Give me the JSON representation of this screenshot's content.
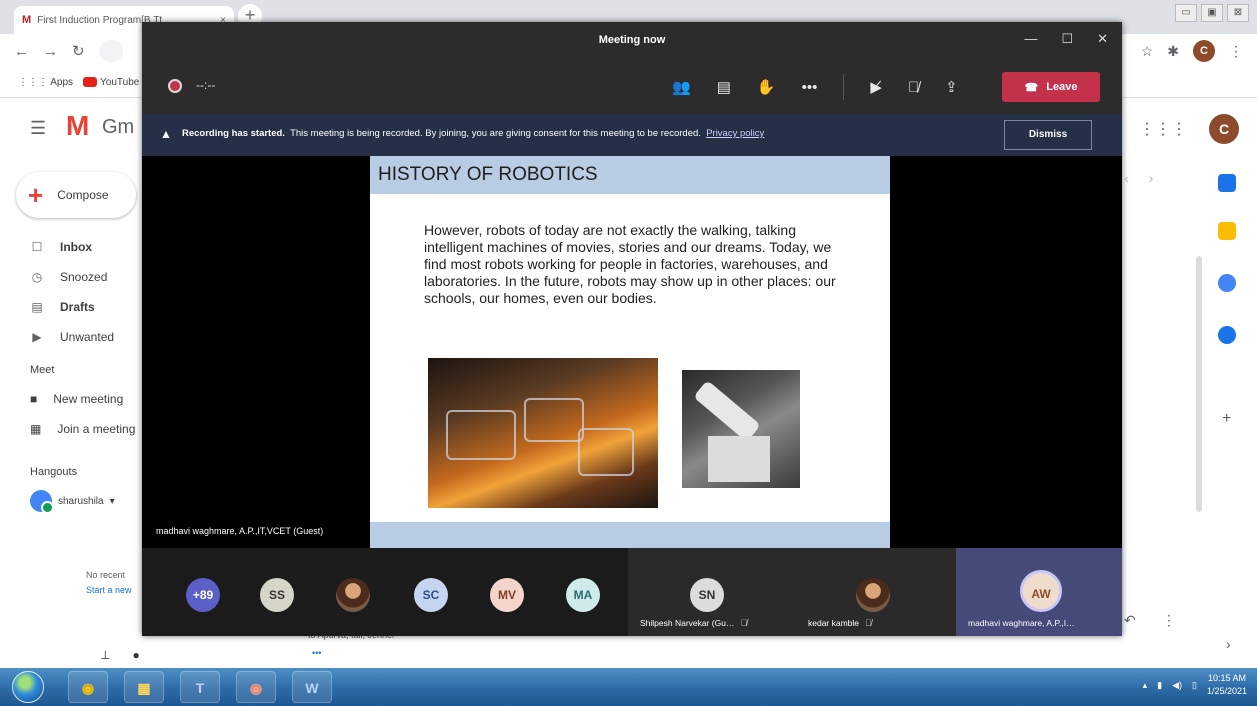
{
  "chrome": {
    "tab_title": "First Induction Program[B.Tt…",
    "tab_close": "×",
    "new_tab": "+",
    "window_controls": [
      "▭",
      "▣",
      "⊠"
    ],
    "bookmarks": [
      {
        "label": "Apps",
        "icon": "apps-grid-icon"
      },
      {
        "label": "YouTube",
        "icon": "youtube-icon"
      }
    ],
    "profile_initial": "C"
  },
  "gmail": {
    "logo_letter": "M",
    "logo_text": "Gm",
    "compose_label": "Compose",
    "nav": [
      {
        "label": "Inbox",
        "icon": "inbox-icon",
        "bold": true
      },
      {
        "label": "Snoozed",
        "icon": "clock-icon",
        "bold": false
      },
      {
        "label": "Drafts",
        "icon": "draft-icon",
        "bold": true
      },
      {
        "label": "Unwanted",
        "icon": "label-icon",
        "bold": false
      }
    ],
    "meet_heading": "Meet",
    "meet_items": [
      {
        "label": "New meeting",
        "icon": "video-icon"
      },
      {
        "label": "Join a meeting",
        "icon": "keyboard-icon"
      }
    ],
    "hangouts_heading": "Hangouts",
    "hangouts_user": "sharushila",
    "no_recent": "No recent",
    "start_new": "Start a new",
    "profile_initial": "C",
    "email_snippet": "to Apurva, tail, Jenner",
    "email_more": "•••"
  },
  "meeting": {
    "window_title": "Meeting now",
    "timer": "--:--",
    "leave_label": "Leave",
    "banner_bold": "Recording has started.",
    "banner_text": "This meeting is being recorded. By joining, you are giving consent for this meeting to be recorded.",
    "banner_link": "Privacy policy",
    "dismiss_label": "Dismiss",
    "presenter": "madhavi waghmare, A.P.,IT,VCET (Guest)",
    "slide": {
      "title": "HISTORY OF ROBOTICS",
      "body": "However, robots of today are not exactly the walking, talking intelligent machines of movies, stories and our dreams. Today, we find most robots working for people in factories, warehouses, and laboratories. In the future, robots may show up in other places: our schools, our homes, even our bodies."
    },
    "participants": [
      {
        "initials": "+89",
        "bg": "#5b5fc7",
        "fg": "#ffffff"
      },
      {
        "initials": "SS",
        "bg": "#d6d6c8",
        "fg": "#333333"
      },
      {
        "initials": "",
        "bg": "photo",
        "fg": "#ffffff"
      },
      {
        "initials": "SC",
        "bg": "#c5d4ef",
        "fg": "#2b4f8c"
      },
      {
        "initials": "MV",
        "bg": "#f3d5cc",
        "fg": "#8a3b25"
      },
      {
        "initials": "MA",
        "bg": "#cfeaea",
        "fg": "#2d6e6e"
      }
    ],
    "tiles": [
      {
        "initials": "SN",
        "name": "Shilpesh Narvekar (Gu…",
        "bg": "#dcdcdc",
        "fg": "#333333",
        "muted": true
      },
      {
        "initials": "",
        "name": "kedar kamble",
        "bg": "photo",
        "fg": "#ffffff",
        "muted": true
      },
      {
        "initials": "AW",
        "name": "madhavi waghmare, A.P.,I…",
        "bg": "#f0dccd",
        "fg": "#8a4f2c",
        "muted": false
      }
    ]
  },
  "taskbar": {
    "clock_time": "10:15 AM",
    "clock_date": "1/25/2021"
  },
  "colors": {
    "teams_purple": "#5b5fc7",
    "leave_red": "#c4314b",
    "banner": "#252f46",
    "slide_title_bar": "#b8cce4"
  }
}
